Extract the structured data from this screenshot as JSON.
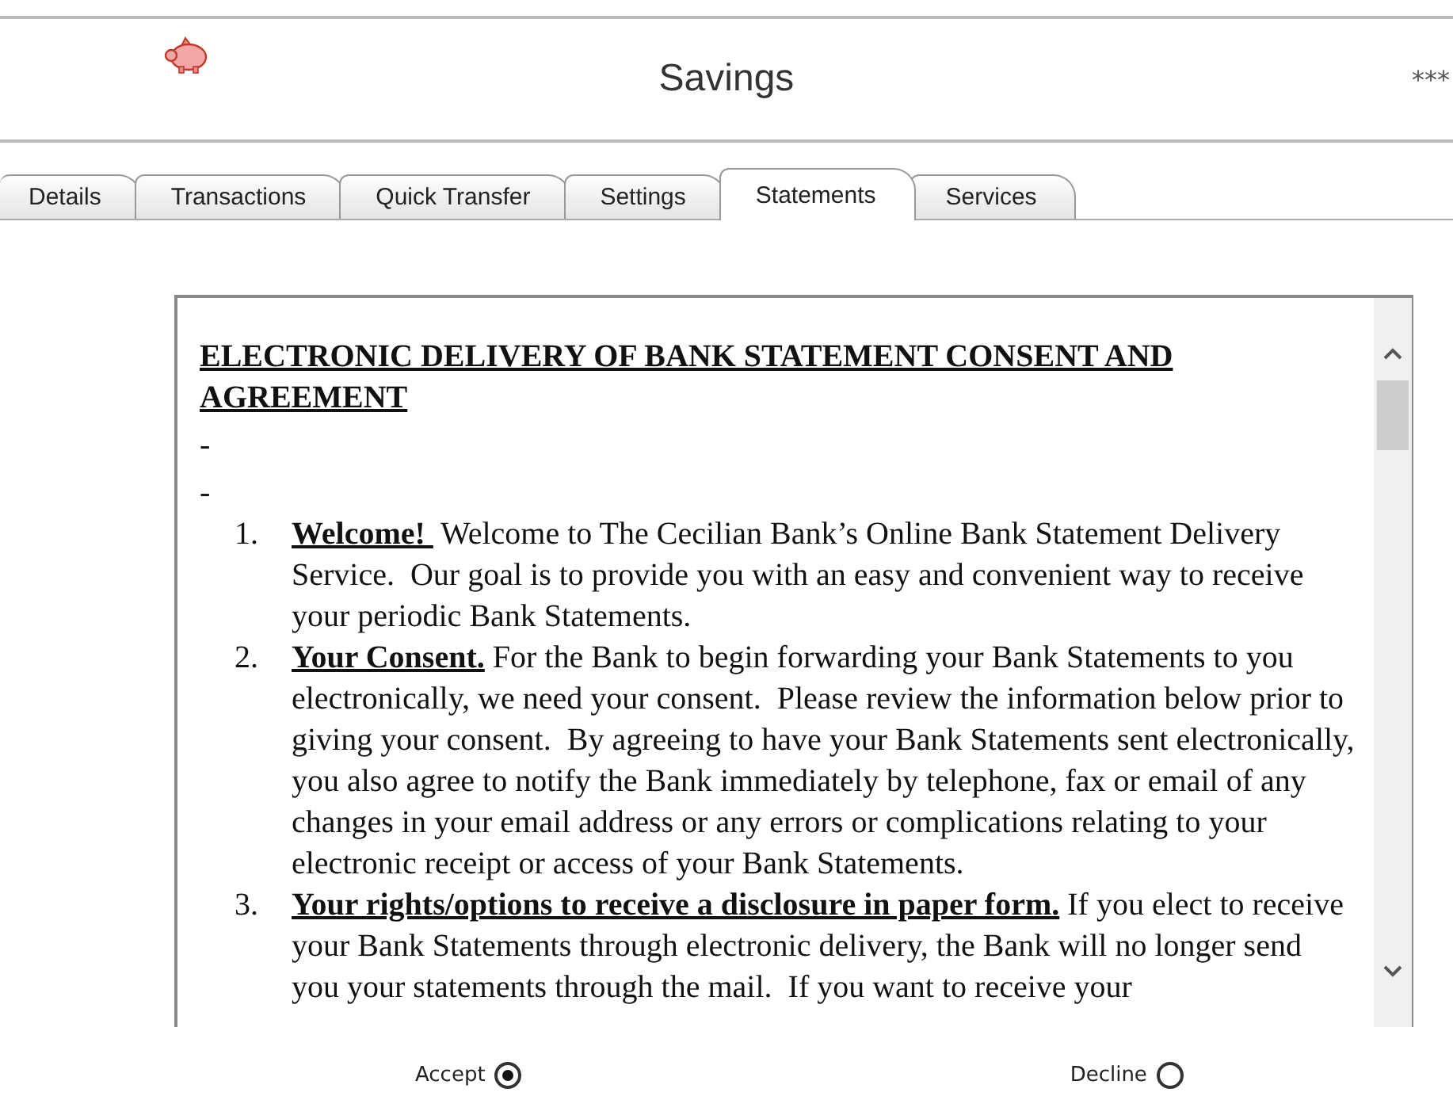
{
  "header": {
    "title": "Savings",
    "masked_number": "***"
  },
  "tabs": [
    {
      "label": "Details",
      "selected": false
    },
    {
      "label": "Transactions",
      "selected": false
    },
    {
      "label": "Quick Transfer",
      "selected": false
    },
    {
      "label": "Settings",
      "selected": false
    },
    {
      "label": "Statements",
      "selected": true
    },
    {
      "label": "Services",
      "selected": false
    }
  ],
  "agreement": {
    "title": "ELECTRONIC DELIVERY OF BANK STATEMENT CONSENT AND AGREEMENT",
    "dashes": [
      "-",
      "-"
    ],
    "items": [
      {
        "number": "1.",
        "heading": "Welcome! ",
        "text": "Welcome to The Cecilian Bank’s Online Bank Statement Delivery Service.  Our goal is to provide you with an easy and convenient way to receive your periodic Bank Statements."
      },
      {
        "number": "2.",
        "heading": "Your Consent.",
        "text": "For the Bank to begin forwarding your Bank Statements to you electronically, we need your consent.  Please review the information below prior to giving your consent.  By agreeing to have your Bank Statements sent electronically, you also agree to notify the Bank immediately by telephone, fax or email of any changes in your email address or any errors or complications relating to your electronic receipt or access of your Bank Statements."
      },
      {
        "number": "3.",
        "heading": "Your rights/options to receive a disclosure in paper form.",
        "text": "If you elect to receive your Bank Statements through electronic delivery, the Bank will no longer send you your statements through the mail.  If you want to receive your"
      }
    ]
  },
  "choices": [
    {
      "label": "Accept",
      "selected": true
    },
    {
      "label": "Decline",
      "selected": false
    }
  ]
}
